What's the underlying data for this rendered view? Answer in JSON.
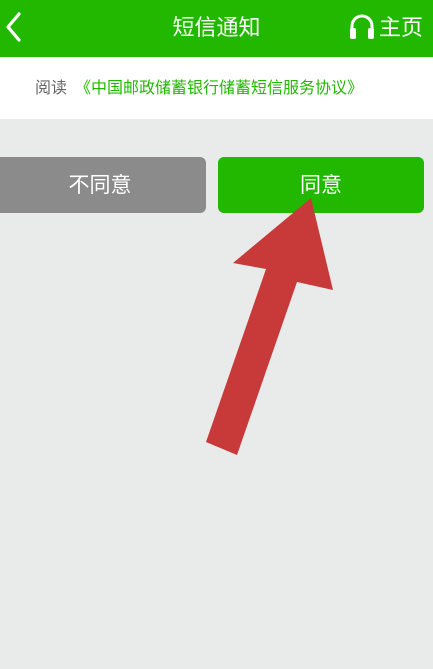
{
  "header": {
    "title": "短信通知",
    "home_label": "主页"
  },
  "agreement": {
    "prefix": "阅读",
    "link_text": "《中国邮政储蓄银行储蓄短信服务协议》"
  },
  "buttons": {
    "disagree_label": "不同意",
    "agree_label": "同意"
  },
  "colors": {
    "brand_green": "#22b800",
    "disagree_gray": "#8b8b8b",
    "background": "#e9ebea",
    "annotation_arrow": "#c83a3a"
  },
  "icons": {
    "back": "chevron-left-icon",
    "home": "headset-icon",
    "annotation": "arrow-annotation-icon"
  }
}
